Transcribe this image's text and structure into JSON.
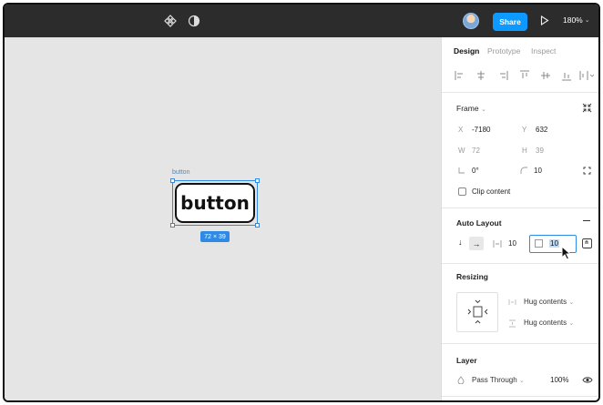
{
  "topbar": {
    "share_label": "Share",
    "zoom_label": "180%",
    "icons": [
      "component-icon",
      "contrast-icon",
      "avatar",
      "play-icon",
      "chevron-down-icon"
    ]
  },
  "canvas": {
    "frame_label": "button",
    "button_text": "button",
    "size_badge": "72 × 39"
  },
  "panel": {
    "tabs": [
      "Design",
      "Prototype",
      "Inspect"
    ],
    "active_tab": "Design",
    "frame": {
      "title": "Frame",
      "x_label": "X",
      "x_value": "-7180",
      "y_label": "Y",
      "y_value": "632",
      "w_label": "W",
      "w_value": "72",
      "h_label": "H",
      "h_value": "39",
      "rotation_value": "0°",
      "radius_value": "10",
      "clip_label": "Clip content"
    },
    "auto_layout": {
      "title": "Auto Layout",
      "spacing_value": "10",
      "padding_value": "10"
    },
    "resizing": {
      "title": "Resizing",
      "horizontal": "Hug contents",
      "vertical": "Hug contents"
    },
    "layer": {
      "title": "Layer",
      "blend": "Pass Through",
      "opacity": "100%"
    }
  },
  "colors": {
    "topbar": "#2c2c2c",
    "accent": "#0d99ff",
    "selection": "#2f8ae6",
    "canvas": "#e5e5e5"
  }
}
